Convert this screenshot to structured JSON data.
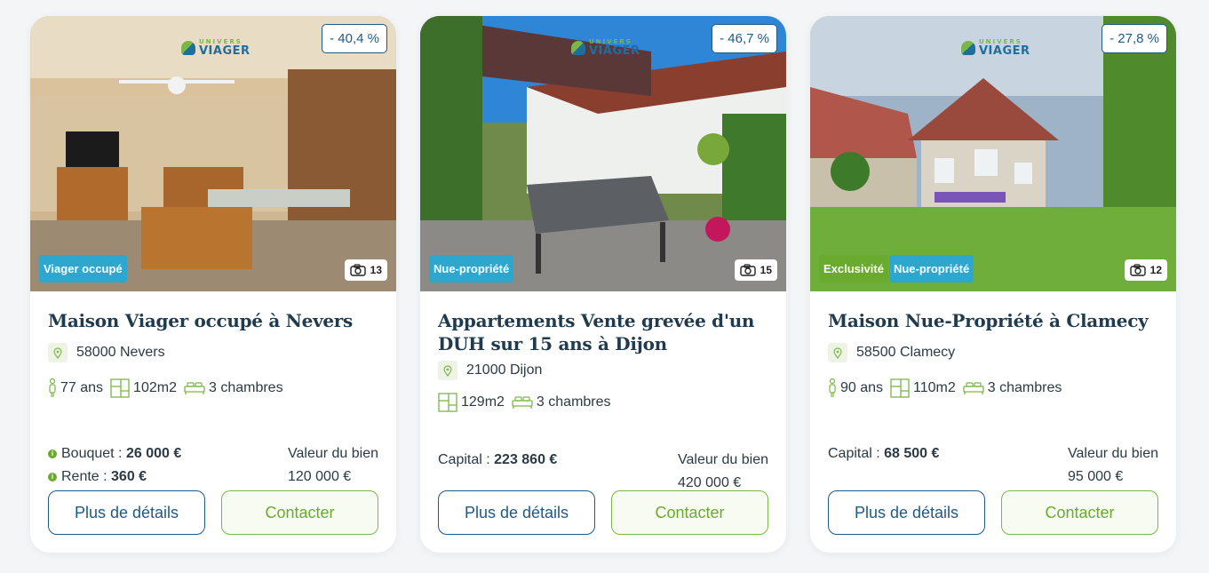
{
  "cards": [
    {
      "logo_top": "UNIVERS",
      "logo_main": "VIAGER",
      "discount": "- 40,4 %",
      "tags": [
        {
          "label": "Viager occupé",
          "color": "blue"
        }
      ],
      "photo_count": "13",
      "title": "Maison Viager occupé à Nevers",
      "location": "58000 Nevers",
      "age": "77 ans",
      "surface": "102m2",
      "rooms": "3 chambres",
      "bouquet_label": "Bouquet : ",
      "bouquet_value": "26 000 €",
      "rente_label": "Rente : ",
      "rente_value": "360 €",
      "valeur_label": "Valeur du bien",
      "valeur_value": "120 000 €",
      "details_label": "Plus de détails",
      "contact_label": "Contacter"
    },
    {
      "logo_top": "UNIVERS",
      "logo_main": "VIAGER",
      "discount": "- 46,7 %",
      "tags": [
        {
          "label": "Nue-propriété",
          "color": "blue"
        }
      ],
      "photo_count": "15",
      "title": "Appartements Vente grevée d'un DUH sur 15 ans à Dijon",
      "location": "21000 Dijon",
      "surface": "129m2",
      "rooms": "3 chambres",
      "capital_label": "Capital : ",
      "capital_value": "223 860 €",
      "valeur_label": "Valeur du bien",
      "valeur_value": "420 000 €",
      "details_label": "Plus de détails",
      "contact_label": "Contacter"
    },
    {
      "logo_top": "UNIVERS",
      "logo_main": "VIAGER",
      "discount": "- 27,8 %",
      "tags": [
        {
          "label": "Exclusivité",
          "color": "green"
        },
        {
          "label": "Nue-propriété",
          "color": "blue"
        }
      ],
      "photo_count": "12",
      "title": "Maison Nue-Propriété à Clamecy",
      "location": "58500 Clamecy",
      "age": "90 ans",
      "surface": "110m2",
      "rooms": "3 chambres",
      "capital_label": "Capital : ",
      "capital_value": "68 500 €",
      "valeur_label": "Valeur du bien",
      "valeur_value": "95 000 €",
      "details_label": "Plus de détails",
      "contact_label": "Contacter"
    }
  ],
  "colors": {
    "primary_blue": "#1e5a86",
    "accent_green": "#7ab648",
    "tag_blue": "#2ea7cf",
    "tag_green": "#6aaa2e"
  }
}
